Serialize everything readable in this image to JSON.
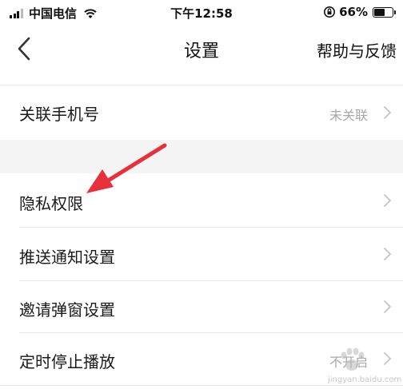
{
  "status_bar": {
    "carrier": "中国电信",
    "time": "下午12:58",
    "battery_percent_text": "66%",
    "battery_level": 0.66
  },
  "nav": {
    "title": "设置",
    "help_label": "帮助与反馈"
  },
  "rows": [
    {
      "label": "关联手机号",
      "value": "未关联"
    },
    {
      "label": "隐私权限",
      "value": ""
    },
    {
      "label": "推送通知设置",
      "value": ""
    },
    {
      "label": "邀请弹窗设置",
      "value": ""
    },
    {
      "label": "定时停止播放",
      "value": "不开启"
    }
  ],
  "watermark": {
    "text": "jingyan.baidu.com"
  },
  "colors": {
    "annotation_arrow": "#e8303a",
    "section_gap": "#f4f4f4",
    "secondary_text": "#a8a8a8"
  }
}
